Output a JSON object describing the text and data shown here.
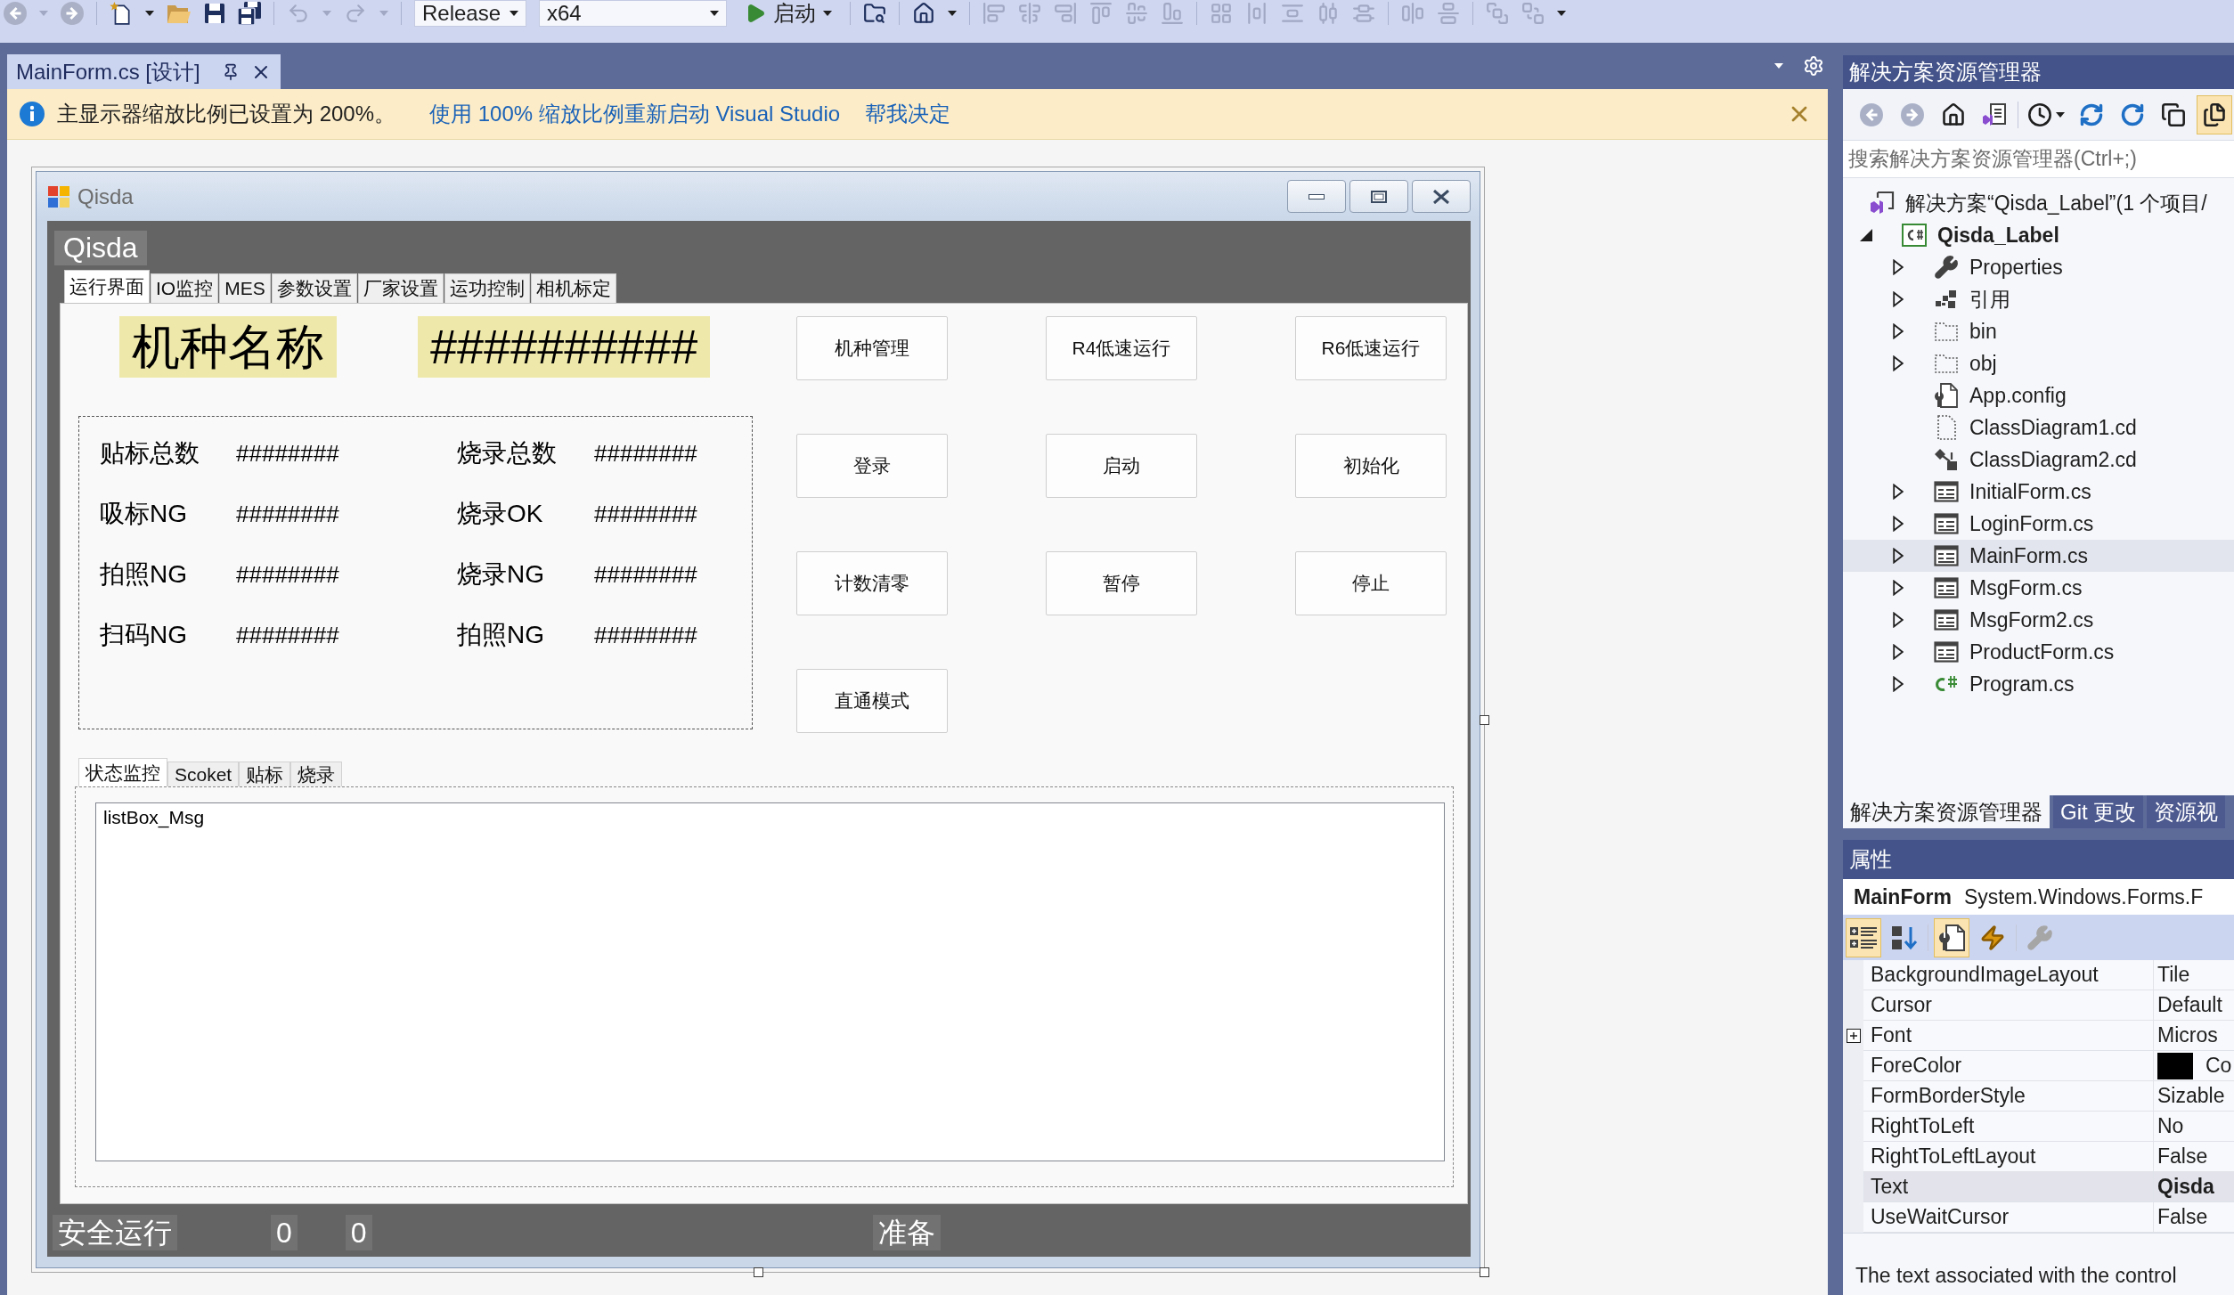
{
  "toolbar": {
    "tools_left": [
      {
        "kind": "back",
        "disabled": true
      },
      {
        "kind": "forward",
        "disabled": true
      },
      {
        "kind": "new-project",
        "disabled": false
      },
      {
        "kind": "open",
        "disabled": false
      },
      {
        "kind": "save",
        "disabled": false
      },
      {
        "kind": "save-all",
        "disabled": false
      },
      {
        "kind": "undo",
        "disabled": true
      },
      {
        "kind": "redo",
        "disabled": true
      }
    ],
    "configuration": "Release",
    "platform": "x64",
    "start_label": "启动",
    "tools_right": [
      {
        "kind": "find-in-files",
        "disabled": false
      },
      {
        "kind": "home",
        "disabled": false
      },
      {
        "kind": "align-left",
        "disabled": true
      },
      {
        "kind": "align-center",
        "disabled": true
      },
      {
        "kind": "align-right",
        "disabled": true
      },
      {
        "kind": "align-top",
        "disabled": true
      },
      {
        "kind": "align-middle",
        "disabled": true
      },
      {
        "kind": "align-bottom",
        "disabled": true
      },
      {
        "kind": "size-to-grid",
        "disabled": true
      },
      {
        "kind": "space-horizontal",
        "disabled": true
      },
      {
        "kind": "space-vertical",
        "disabled": true
      },
      {
        "kind": "distribute-horizontal",
        "disabled": true
      },
      {
        "kind": "distribute-vertical",
        "disabled": true
      },
      {
        "kind": "center-horizontal",
        "disabled": true
      },
      {
        "kind": "center-vertical",
        "disabled": true
      },
      {
        "kind": "bring-to-front",
        "disabled": true
      },
      {
        "kind": "send-to-back",
        "disabled": true
      }
    ]
  },
  "document_tabs": [
    {
      "label": "MainForm.cs [设计]",
      "selected": true
    }
  ],
  "info_bar": {
    "message": "主显示器缩放比例已设置为 200%。",
    "links": [
      "使用 100% 缩放比例重新启动 Visual Studio",
      "帮我决定"
    ]
  },
  "form": {
    "title": "Qisda",
    "header_label": "Qisda",
    "tabs": [
      {
        "label": "运行界面",
        "selected": true
      },
      {
        "label": "IO监控",
        "selected": false
      },
      {
        "label": "MES",
        "selected": false
      },
      {
        "label": "参数设置",
        "selected": false
      },
      {
        "label": "厂家设置",
        "selected": false
      },
      {
        "label": "运功控制",
        "selected": false
      },
      {
        "label": "相机标定",
        "selected": false
      }
    ],
    "model_name_label": "机种名称",
    "model_name_value": "##########",
    "counters": [
      {
        "label": "贴标总数",
        "value": "########"
      },
      {
        "label": "烧录总数",
        "value": "########"
      },
      {
        "label": "吸标NG",
        "value": "########"
      },
      {
        "label": "烧录OK",
        "value": "########"
      },
      {
        "label": "拍照NG",
        "value": "########"
      },
      {
        "label": "烧录NG",
        "value": "########"
      },
      {
        "label": "扫码NG",
        "value": "########"
      },
      {
        "label": "拍照NG",
        "value": "########"
      }
    ],
    "button_rows": [
      [
        "机种管理",
        "R4低速运行",
        "R6低速运行"
      ],
      [
        "登录",
        "启动",
        "初始化"
      ],
      [
        "计数清零",
        "暂停",
        "停止"
      ],
      [
        "直通模式"
      ]
    ],
    "log_tabs": [
      {
        "label": "状态监控",
        "selected": true
      },
      {
        "label": "Scoket",
        "selected": false
      },
      {
        "label": "贴标",
        "selected": false
      },
      {
        "label": "烧录",
        "selected": false
      }
    ],
    "log_list": {
      "items": [
        "listBox_Msg"
      ]
    },
    "status_bar": [
      "安全运行",
      "0",
      "0",
      "准备"
    ]
  },
  "solution_explorer": {
    "title": "解决方案资源管理器",
    "tools": [
      {
        "kind": "back",
        "disabled": true,
        "on": false
      },
      {
        "kind": "forward",
        "disabled": true,
        "on": false
      },
      {
        "kind": "home",
        "disabled": false,
        "on": false
      },
      {
        "kind": "switch-views",
        "disabled": false,
        "on": false
      },
      {
        "kind": "pending-changes",
        "disabled": false,
        "on": false
      },
      {
        "kind": "sync",
        "disabled": false,
        "on": false
      },
      {
        "kind": "refresh",
        "disabled": false,
        "on": false
      },
      {
        "kind": "collapse-all",
        "disabled": false,
        "on": false
      },
      {
        "kind": "show-all-files",
        "disabled": false,
        "on": true
      }
    ],
    "search": {
      "placeholder": "搜索解决方案资源管理器(Ctrl+;)"
    },
    "tree": [
      {
        "label": "解决方案“Qisda_Label”(1 个项目/",
        "kind": "solution",
        "selected": false,
        "children": [
          {
            "label": "Qisda_Label",
            "kind": "project",
            "expanded": true,
            "selected": false,
            "children": [
              {
                "label": "Properties",
                "kind": "properties",
                "expanded": false,
                "selected": false
              },
              {
                "label": "引用",
                "kind": "references",
                "expanded": false,
                "selected": false
              },
              {
                "label": "bin",
                "kind": "excluded-folder",
                "expanded": false,
                "selected": false
              },
              {
                "label": "obj",
                "kind": "excluded-folder",
                "expanded": false,
                "selected": false
              },
              {
                "label": "App.config",
                "kind": "config-file",
                "selected": false
              },
              {
                "label": "ClassDiagram1.cd",
                "kind": "missing-file",
                "selected": false
              },
              {
                "label": "ClassDiagram2.cd",
                "kind": "class-diagram",
                "selected": false
              },
              {
                "label": "InitialForm.cs",
                "kind": "form",
                "expanded": false,
                "selected": false
              },
              {
                "label": "LoginForm.cs",
                "kind": "form",
                "expanded": false,
                "selected": false
              },
              {
                "label": "MainForm.cs",
                "kind": "form",
                "expanded": false,
                "selected": true
              },
              {
                "label": "MsgForm.cs",
                "kind": "form",
                "expanded": false,
                "selected": false
              },
              {
                "label": "MsgForm2.cs",
                "kind": "form",
                "expanded": false,
                "selected": false
              },
              {
                "label": "ProductForm.cs",
                "kind": "form",
                "expanded": false,
                "selected": false
              },
              {
                "label": "Program.cs",
                "kind": "code-file",
                "expanded": false,
                "selected": false
              }
            ]
          }
        ]
      }
    ],
    "tabs": [
      {
        "label": "解决方案资源管理器",
        "selected": true
      },
      {
        "label": "Git 更改",
        "selected": false
      },
      {
        "label": "资源视",
        "selected": false
      }
    ]
  },
  "properties": {
    "title": "属性",
    "object_name": "MainForm",
    "object_type": "System.Windows.Forms.F",
    "tools": [
      {
        "kind": "categorized",
        "selected": true,
        "disabled": false
      },
      {
        "kind": "alphabetical",
        "selected": false,
        "disabled": false
      },
      {
        "kind": "properties",
        "selected": true,
        "disabled": false
      },
      {
        "kind": "events",
        "selected": false,
        "disabled": false
      },
      {
        "kind": "property-pages",
        "selected": false,
        "disabled": true
      }
    ],
    "rows": [
      {
        "name": "BackgroundImageLayout",
        "value": "Tile",
        "kind": "plain",
        "selected": false,
        "modified": false
      },
      {
        "name": "Cursor",
        "value": "Default",
        "kind": "plain",
        "selected": false,
        "modified": false
      },
      {
        "name": "Font",
        "value": "Micros",
        "kind": "group",
        "selected": false,
        "modified": false
      },
      {
        "name": "ForeColor",
        "value": "Co",
        "kind": "color",
        "color": "#000000",
        "selected": false,
        "modified": false
      },
      {
        "name": "FormBorderStyle",
        "value": "Sizable",
        "kind": "plain",
        "selected": false,
        "modified": false
      },
      {
        "name": "RightToLeft",
        "value": "No",
        "kind": "plain",
        "selected": false,
        "modified": false
      },
      {
        "name": "RightToLeftLayout",
        "value": "False",
        "kind": "plain",
        "selected": false,
        "modified": false
      },
      {
        "name": "Text",
        "value": "Qisda",
        "kind": "plain",
        "selected": true,
        "modified": true
      },
      {
        "name": "UseWaitCursor",
        "value": "False",
        "kind": "plain",
        "selected": false,
        "modified": false
      }
    ],
    "description": "The text associated with the control"
  }
}
